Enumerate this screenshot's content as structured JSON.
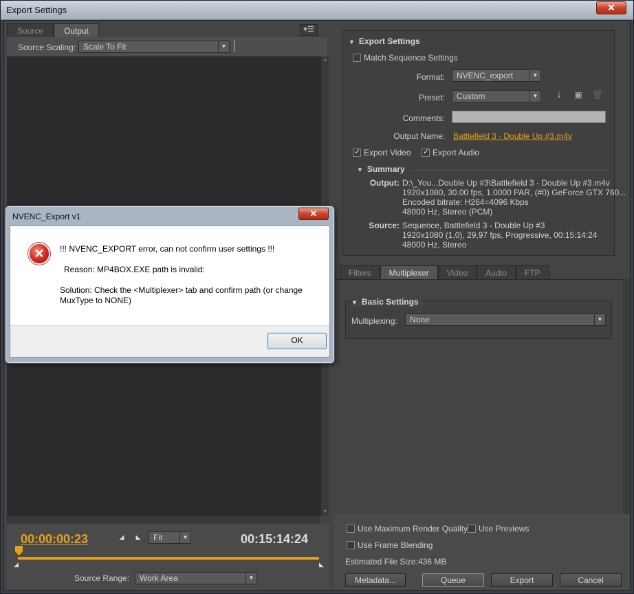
{
  "window": {
    "title": "Export Settings",
    "close": "✕"
  },
  "left": {
    "tabs": [
      {
        "label": "Source"
      },
      {
        "label": "Output"
      }
    ],
    "panel_menu_icon": "panel-menu-icon",
    "source_scaling_label": "Source Scaling:",
    "source_scaling_value": "Scale To Fit",
    "timecode_current": "00:00:00:23",
    "timecode_duration": "00:15:14:24",
    "zoom_value": "Fit",
    "source_range_label": "Source Range:",
    "source_range_value": "Work Area"
  },
  "export_settings": {
    "title": "Export Settings",
    "match_sequence_label": "Match Sequence Settings",
    "format_label": "Format:",
    "format_value": "NVENC_export",
    "preset_label": "Preset:",
    "preset_value": "Custom",
    "comments_label": "Comments:",
    "output_name_label": "Output Name:",
    "output_name_value": "Battlefield 3 - Double Up #3.m4v",
    "export_video_label": "Export Video",
    "export_audio_label": "Export Audio",
    "summary_title": "Summary",
    "output_label": "Output:",
    "output_lines": [
      "D:\\_You...Double Up #3\\Battlefield 3 - Double Up #3.m4v",
      "1920x1080, 30.00 fps, 1.0000 PAR, (#0) GeForce GTX 760...",
      "Encoded bitrate: H264=4096 Kbps",
      "48000 Hz, Stereo (PCM)"
    ],
    "source_label": "Source:",
    "source_lines": [
      "Sequence, Battlefield 3 - Double Up #3",
      "1920x1080 (1,0), 29,97 fps, Progressive, 00:15:14:24",
      "48000 Hz, Stereo"
    ]
  },
  "right_tabs": [
    {
      "label": "Filters"
    },
    {
      "label": "Multiplexer"
    },
    {
      "label": "Video"
    },
    {
      "label": "Audio"
    },
    {
      "label": "FTP"
    }
  ],
  "basic_settings": {
    "title": "Basic Settings",
    "multiplexing_label": "Multiplexing:",
    "multiplexing_value": "None"
  },
  "bottom": {
    "max_render_quality": "Use Maximum Render Quality",
    "use_previews": "Use Previews",
    "frame_blending": "Use Frame Blending",
    "estimated_size_label": "Estimated File Size:",
    "estimated_size_value": "436 MB",
    "metadata_button": "Metadata...",
    "queue_button": "Queue",
    "export_button": "Export",
    "cancel_button": "Cancel"
  },
  "dialog": {
    "title": "NVENC_Export v1",
    "close": "✕",
    "line1": "!!! NVENC_EXPORT error, can not confirm user settings !!!",
    "line2": "Reason: MP4BOX.EXE path is invalid:",
    "line3": "Solution: Check the <Multiplexer> tab and confirm path (or change",
    "line4": "MuxType to NONE)",
    "ok_button": "OK",
    "icon": "error-icon"
  }
}
